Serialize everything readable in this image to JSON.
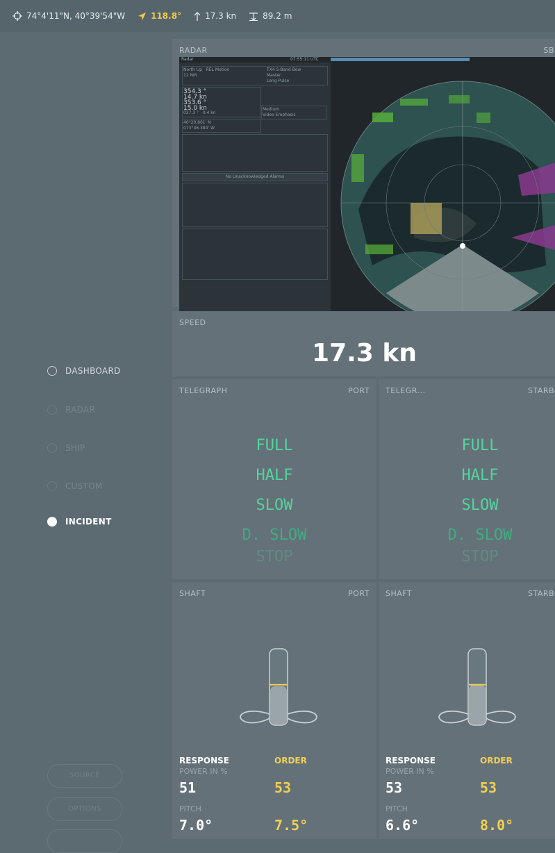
{
  "topbar": {
    "position": "74°4'11\"N, 40°39'54\"W",
    "heading": "118.8°",
    "speed": "17.3 kn",
    "depth": "89.2 m"
  },
  "nav": {
    "items": [
      {
        "label": "DASHBOARD",
        "state": "normal"
      },
      {
        "label": "RADAR",
        "state": "faded"
      },
      {
        "label": "SHIP",
        "state": "faded"
      },
      {
        "label": "CUSTOM",
        "state": "faded"
      },
      {
        "label": "INCIDENT",
        "state": "active"
      }
    ],
    "buttons": [
      "SOURCE",
      "OPTIONS",
      ""
    ]
  },
  "radar": {
    "title": "RADAR",
    "right_label": "SB",
    "screen": {
      "header_title": "Radar",
      "header_time": "07:55:11 UTC",
      "orientation": "North Up",
      "motion": "REL Motion",
      "range": "12 NM",
      "band": "TX4 S-Band Bow",
      "master": "Master",
      "long_pulse": "Long Pulse",
      "hdg": "354.3 °",
      "stw": "14.7 kn",
      "cog": "353.6 °",
      "sog": "15.0 kn",
      "set": "027.3 °",
      "drift": "0.4 kn",
      "lat": "40°20.801' N",
      "lon": "073°46.384' W",
      "alarms": "No Unacknowledged Alarms",
      "video": "Video Emphasis",
      "gain_mode": "Medium"
    }
  },
  "speed": {
    "title": "SPEED",
    "value": "17.3 kn"
  },
  "telegraph": [
    {
      "title": "TELEGRAPH",
      "side": "PORT",
      "levels": [
        "FULL",
        "HALF",
        "SLOW",
        "D. SLOW",
        "STOP"
      ]
    },
    {
      "title": "TELEGR...",
      "side": "STARBO",
      "levels": [
        "FULL",
        "HALF",
        "SLOW",
        "D. SLOW",
        "STOP"
      ]
    }
  ],
  "shaft": [
    {
      "title": "SHAFT",
      "side": "PORT",
      "response_label": "RESPONSE",
      "order_label": "ORDER",
      "power_label": "POWER IN %",
      "power_response": "51",
      "power_order": "53",
      "pitch_label": "PITCH",
      "pitch_response": "7.0°",
      "pitch_order": "7.5°",
      "response_level": 0.51,
      "order_level": 0.53
    },
    {
      "title": "SHAFT",
      "side": "STARBO",
      "response_label": "RESPONSE",
      "order_label": "ORDER",
      "power_label": "POWER IN %",
      "power_response": "53",
      "power_order": "53",
      "pitch_label": "PITCH",
      "pitch_response": "6.6°",
      "pitch_order": "8.0°",
      "response_level": 0.53,
      "order_level": 0.53
    }
  ],
  "colors": {
    "accent_yellow": "#f2cf52",
    "telegraph_green": "#53d59d",
    "background": "#5c6a72",
    "panel": "#647179"
  }
}
